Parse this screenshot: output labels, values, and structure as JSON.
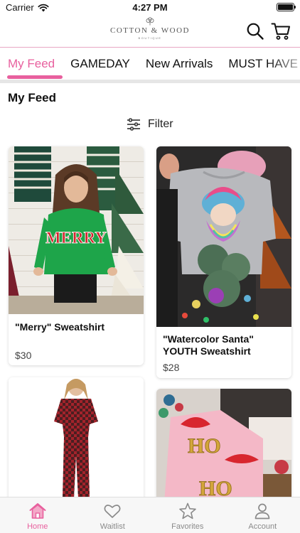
{
  "status_bar": {
    "carrier": "Carrier",
    "time": "4:27 PM"
  },
  "header": {
    "logo_text": "COTTON & WOOD",
    "logo_tagline": "BOUTIQUE",
    "search_icon": "search-icon",
    "cart_icon": "cart-icon"
  },
  "tabs": [
    {
      "label": "My Feed",
      "active": true
    },
    {
      "label": "GAMEDAY",
      "active": false
    },
    {
      "label": "New Arrivals",
      "active": false
    },
    {
      "label": "MUST HAVE",
      "active": false
    }
  ],
  "feed": {
    "title": "My Feed",
    "filter_label": "Filter",
    "filter_icon": "sliders-icon"
  },
  "products": [
    {
      "title": "\"Merry\" Sweatshirt",
      "price": "$30"
    },
    {
      "title": "\"Watercolor Santa\" YOUTH Sweatshirt",
      "price": "$28"
    },
    {
      "title": "",
      "price": ""
    },
    {
      "title": "",
      "price": ""
    }
  ],
  "bottom_nav": [
    {
      "label": "Home",
      "icon": "home-icon",
      "active": true
    },
    {
      "label": "Waitlist",
      "icon": "heart-icon",
      "active": false
    },
    {
      "label": "Favorites",
      "icon": "star-icon",
      "active": false
    },
    {
      "label": "Account",
      "icon": "person-icon",
      "active": false
    }
  ],
  "colors": {
    "accent": "#e8609e",
    "tab_divider": "#e6e6e6",
    "inactive": "#8a8a8a"
  }
}
